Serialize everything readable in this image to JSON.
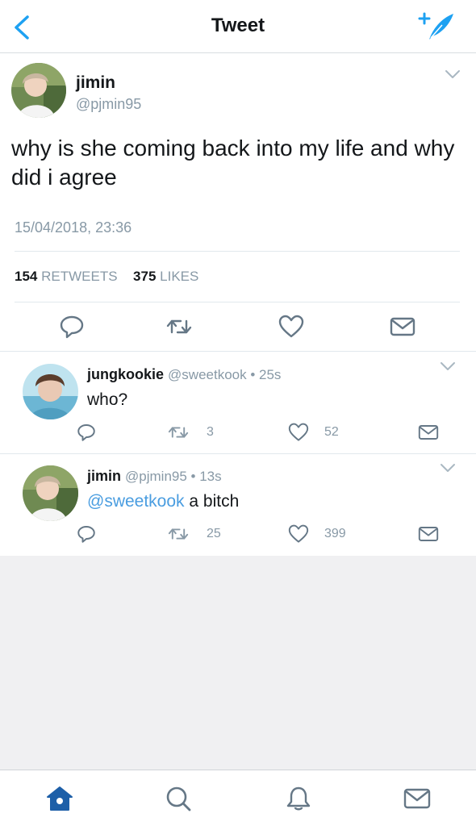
{
  "nav": {
    "title": "Tweet",
    "back_icon": "chevron-left-icon",
    "compose_icon": "compose-feather-icon"
  },
  "main_tweet": {
    "name": "jimin",
    "handle": "@pjmin95",
    "text": "why is she coming back into my life and why did i agree",
    "timestamp": "15/04/2018, 23:36",
    "retweets_count": "154",
    "retweets_label": "RETWEETS",
    "likes_count": "375",
    "likes_label": "LIKES"
  },
  "replies": [
    {
      "name": "jungkookie",
      "meta": "@sweetkook • 25s",
      "text": "who?",
      "mention": "",
      "retweets": "3",
      "likes": "52"
    },
    {
      "name": "jimin",
      "meta": "@pjmin95 • 13s",
      "mention": "@sweetkook",
      "text": " a bitch",
      "retweets": "25",
      "likes": "399"
    }
  ],
  "tabbar": {
    "items": [
      "home-icon",
      "search-icon",
      "notifications-bell-icon",
      "messages-envelope-icon"
    ]
  },
  "colors": {
    "accent": "#1da1f2",
    "gray_text": "#8899a6",
    "icon_gray": "#8899a6"
  }
}
